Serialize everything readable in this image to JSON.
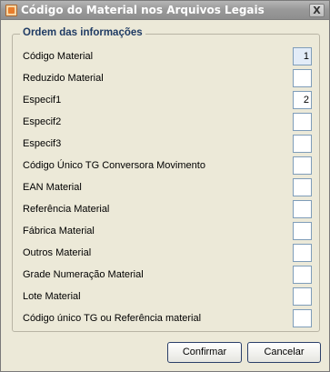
{
  "window": {
    "title": "Código do Material nos Arquivos Legais",
    "close_label": "X"
  },
  "group": {
    "title": "Ordem das informações",
    "rows": [
      {
        "label": "Código Material",
        "value": "1"
      },
      {
        "label": "Reduzido Material",
        "value": ""
      },
      {
        "label": "Especif1",
        "value": "2"
      },
      {
        "label": "Especif2",
        "value": ""
      },
      {
        "label": "Especif3",
        "value": ""
      },
      {
        "label": "Código Único TG Conversora Movimento",
        "value": ""
      },
      {
        "label": "EAN Material",
        "value": ""
      },
      {
        "label": "Referência Material",
        "value": ""
      },
      {
        "label": "Fábrica Material",
        "value": ""
      },
      {
        "label": "Outros Material",
        "value": ""
      },
      {
        "label": "Grade Numeração Material",
        "value": ""
      },
      {
        "label": "Lote Material",
        "value": ""
      },
      {
        "label": "Código único TG ou Referência material",
        "value": ""
      }
    ]
  },
  "buttons": {
    "confirm": "Confirmar",
    "cancel": "Cancelar"
  }
}
